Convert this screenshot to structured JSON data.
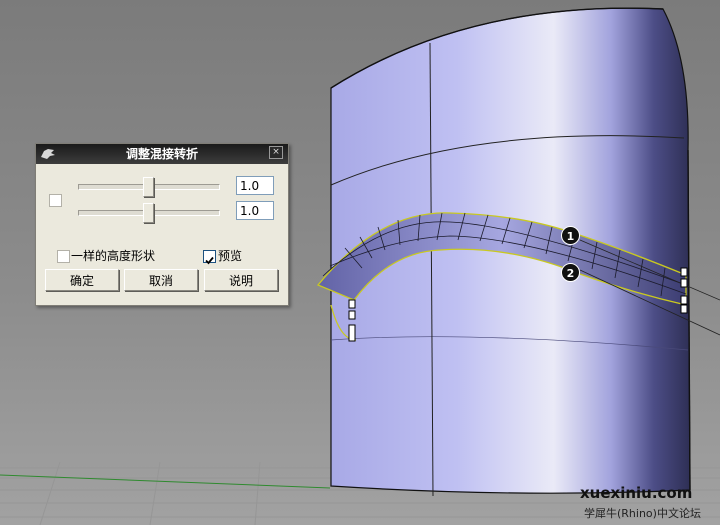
{
  "dialog": {
    "title": "调整混接转折",
    "slider1_value": "1.0",
    "slider2_value": "1.0",
    "same_height_label": "一样的高度形状",
    "preview_label": "预览",
    "ok_label": "确定",
    "cancel_label": "取消",
    "help_label": "说明",
    "close_glyph": "×",
    "slider1_position": 0.5,
    "slider2_position": 0.5,
    "same_height_checked": false,
    "preview_checked": true
  },
  "markers": [
    "1",
    "2"
  ],
  "watermark": {
    "site": "xuexiniu.com",
    "caption": "学犀牛(Rhino)中文论坛"
  },
  "colors": {
    "viewport_bg": "#8c8c8c",
    "surface": "#b5b6ea",
    "titlebar": "#2a2a2a",
    "dialog_bg": "#ebe9dd"
  }
}
